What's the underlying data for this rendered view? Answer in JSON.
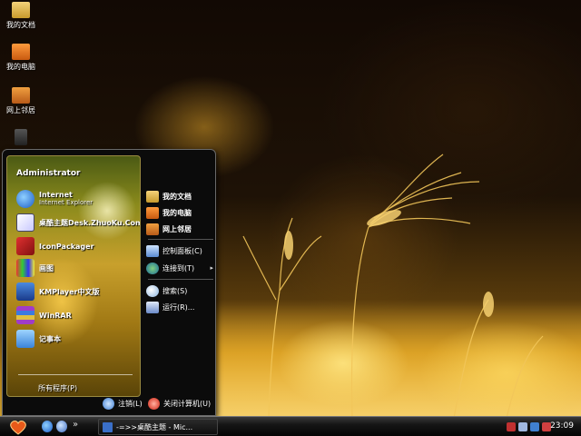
{
  "desktop": {
    "icons": [
      {
        "label": "我的文档",
        "icon": "my-documents-icon"
      },
      {
        "label": "我的电脑",
        "icon": "my-computer-icon"
      },
      {
        "label": "网上邻居",
        "icon": "network-places-icon"
      },
      {
        "label": "",
        "icon": "recycle-bin-icon"
      }
    ]
  },
  "start_menu": {
    "user": "Administrator",
    "programs": [
      {
        "label": "Internet",
        "sub": "Internet Explorer",
        "icon": "internet-explorer-icon"
      },
      {
        "label": "桌酷主题Desk.ZhuoKu.Com",
        "sub": "",
        "icon": "zhuoku-theme-icon"
      },
      {
        "label": "IconPackager",
        "sub": "",
        "icon": "iconpackager-icon"
      },
      {
        "label": "画图",
        "sub": "",
        "icon": "paint-icon"
      },
      {
        "label": "KMPlayer中文版",
        "sub": "",
        "icon": "kmplayer-icon"
      },
      {
        "label": "WinRAR",
        "sub": "",
        "icon": "winrar-icon"
      },
      {
        "label": "记事本",
        "sub": "",
        "icon": "notepad-icon"
      }
    ],
    "all_programs": "所有程序(P)",
    "places": [
      {
        "label": "我的文档",
        "icon": "my-documents-icon"
      },
      {
        "label": "我的电脑",
        "icon": "my-computer-icon"
      },
      {
        "label": "网上邻居",
        "icon": "network-places-icon"
      }
    ],
    "system": [
      {
        "label": "控制面板(C)",
        "icon": "control-panel-icon"
      },
      {
        "label": "连接到(T)",
        "icon": "connect-to-icon",
        "submenu_arrow": "▸"
      }
    ],
    "tools": [
      {
        "label": "搜索(S)",
        "icon": "search-icon"
      },
      {
        "label": "运行(R)...",
        "icon": "run-icon"
      }
    ],
    "logoff": "注销(L)",
    "shutdown": "关闭计算机(U)"
  },
  "taskbar": {
    "quick_launch": [
      "ie-quicklaunch-icon",
      "desktop-quicklaunch-icon",
      "media-quicklaunch-icon"
    ],
    "chevron": "»",
    "task_label": "-=>>桌酷主题 - Mic...",
    "clock": "23:09"
  },
  "colors": {
    "menu_bg": "#0b0b0b",
    "accent_gold": "#e8b83c",
    "start_orb": "#e85a1a"
  }
}
